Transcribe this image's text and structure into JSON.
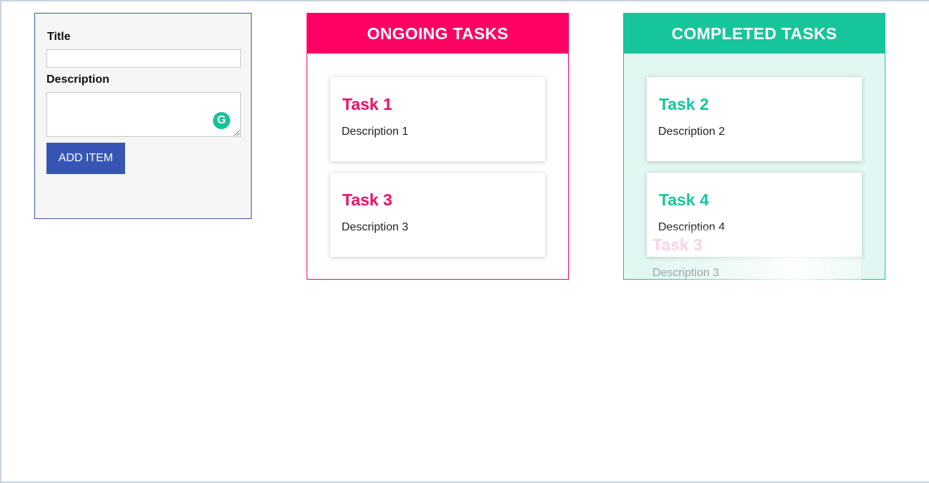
{
  "form": {
    "title_label": "Title",
    "title_value": "",
    "description_label": "Description",
    "description_value": "",
    "grammarly_glyph": "G",
    "add_button_label": "ADD ITEM"
  },
  "columns": {
    "ongoing": {
      "header": "ONGOING TASKS",
      "tasks": [
        {
          "title": "Task 1",
          "description": "Description 1"
        },
        {
          "title": "Task 3",
          "description": "Description 3"
        }
      ]
    },
    "completed": {
      "header": "COMPLETED TASKS",
      "tasks": [
        {
          "title": "Task 2",
          "description": "Description 2"
        },
        {
          "title": "Task 4",
          "description": "Description 4"
        }
      ]
    }
  },
  "drag_ghost": {
    "title": "Task 3",
    "description": "Description 3"
  },
  "colors": {
    "ongoing_accent": "#ff0063",
    "completed_accent": "#17c59b",
    "button": "#3755b5",
    "form_border": "#3d55b0"
  }
}
